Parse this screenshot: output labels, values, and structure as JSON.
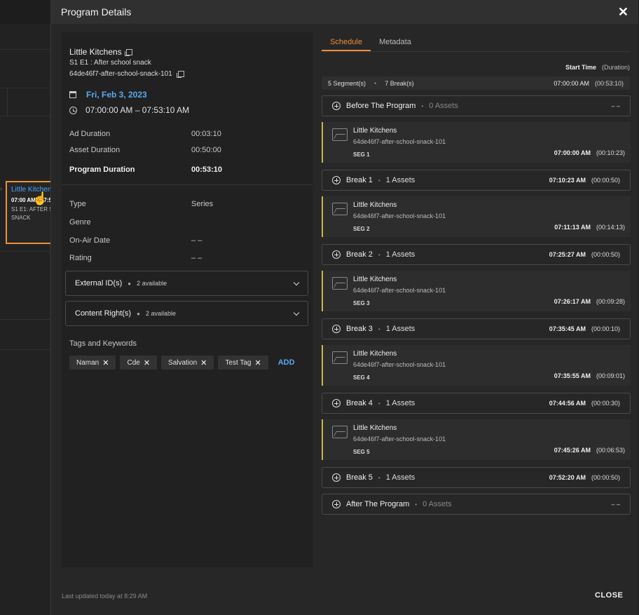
{
  "background": {
    "card": {
      "title": "Little Kitchen",
      "time": "07:00 AM - 07:5",
      "line1": "S1 E1: AFTER S",
      "line2": "SNACK"
    }
  },
  "modal": {
    "title": "Program Details",
    "footer": "Last updated today at 8:29 AM",
    "close_label": "CLOSE"
  },
  "details": {
    "title": "Little Kitchens",
    "episode": "S1 E1 : After school snack",
    "asset_id": "64de46f7-after-school-snack-101",
    "date": "Fri, Feb 3, 2023",
    "time_range": "07:00:00 AM  –  07:53:10 AM",
    "durations": [
      {
        "label": "Ad Duration",
        "value": "00:03:10"
      },
      {
        "label": "Asset Duration",
        "value": "00:50:00"
      },
      {
        "label": "Program Duration",
        "value": "00:53:10"
      }
    ],
    "attributes": [
      {
        "label": "Type",
        "value": "Series"
      },
      {
        "label": "Genre",
        "value": ""
      },
      {
        "label": "On-Air Date",
        "value": "– –"
      },
      {
        "label": "Rating",
        "value": "– –"
      }
    ],
    "external_ids": {
      "label": "External ID(s)",
      "count": "2 available"
    },
    "content_rights": {
      "label": "Content Right(s)",
      "count": "2 available"
    },
    "tags_title": "Tags and Keywords",
    "tags": [
      "Naman",
      "Cde",
      "Salvation",
      "Test Tag"
    ],
    "add_label": "ADD"
  },
  "schedule": {
    "tabs": [
      "Schedule",
      "Metadata"
    ],
    "header_start": "Start Time",
    "header_duration": "(Duration)",
    "summary": {
      "segments": "5 Segment(s)",
      "breaks": "7 Break(s)",
      "start": "07:00:00 AM",
      "duration": "(00:53:10)"
    },
    "before": {
      "name": "Before The Program",
      "assets": "0 Assets",
      "right": "– –"
    },
    "after": {
      "name": "After The Program",
      "assets": "0 Assets",
      "right": "– –"
    },
    "segments": [
      {
        "name": "Little Kitchens",
        "id": "64de46f7-after-school-snack-101",
        "label": "SEG 1",
        "start": "07:00:00 AM",
        "duration": "(00:10:23)"
      },
      {
        "name": "Little Kitchens",
        "id": "64de46f7-after-school-snack-101",
        "label": "SEG 2",
        "start": "07:11:13 AM",
        "duration": "(00:14:13)"
      },
      {
        "name": "Little Kitchens",
        "id": "64de46f7-after-school-snack-101",
        "label": "SEG 3",
        "start": "07:26:17 AM",
        "duration": "(00:09:28)"
      },
      {
        "name": "Little Kitchens",
        "id": "64de46f7-after-school-snack-101",
        "label": "SEG 4",
        "start": "07:35:55 AM",
        "duration": "(00:09:01)"
      },
      {
        "name": "Little Kitchens",
        "id": "64de46f7-after-school-snack-101",
        "label": "SEG 5",
        "start": "07:45:26 AM",
        "duration": "(00:06:53)"
      }
    ],
    "breaks": [
      {
        "name": "Break 1",
        "assets": "1 Assets",
        "start": "07:10:23 AM",
        "duration": "(00:00:50)"
      },
      {
        "name": "Break 2",
        "assets": "1 Assets",
        "start": "07:25:27 AM",
        "duration": "(00:00:50)"
      },
      {
        "name": "Break 3",
        "assets": "1 Assets",
        "start": "07:35:45 AM",
        "duration": "(00:00:10)"
      },
      {
        "name": "Break 4",
        "assets": "1 Assets",
        "start": "07:44:56 AM",
        "duration": "(00:00:30)"
      },
      {
        "name": "Break 5",
        "assets": "1 Assets",
        "start": "07:52:20 AM",
        "duration": "(00:00:50)"
      }
    ]
  },
  "colors": {
    "accent": "#f08c3a",
    "link": "#5aa8f0",
    "segment_bar": "#c8b84a",
    "highlight": "#e8943a"
  }
}
